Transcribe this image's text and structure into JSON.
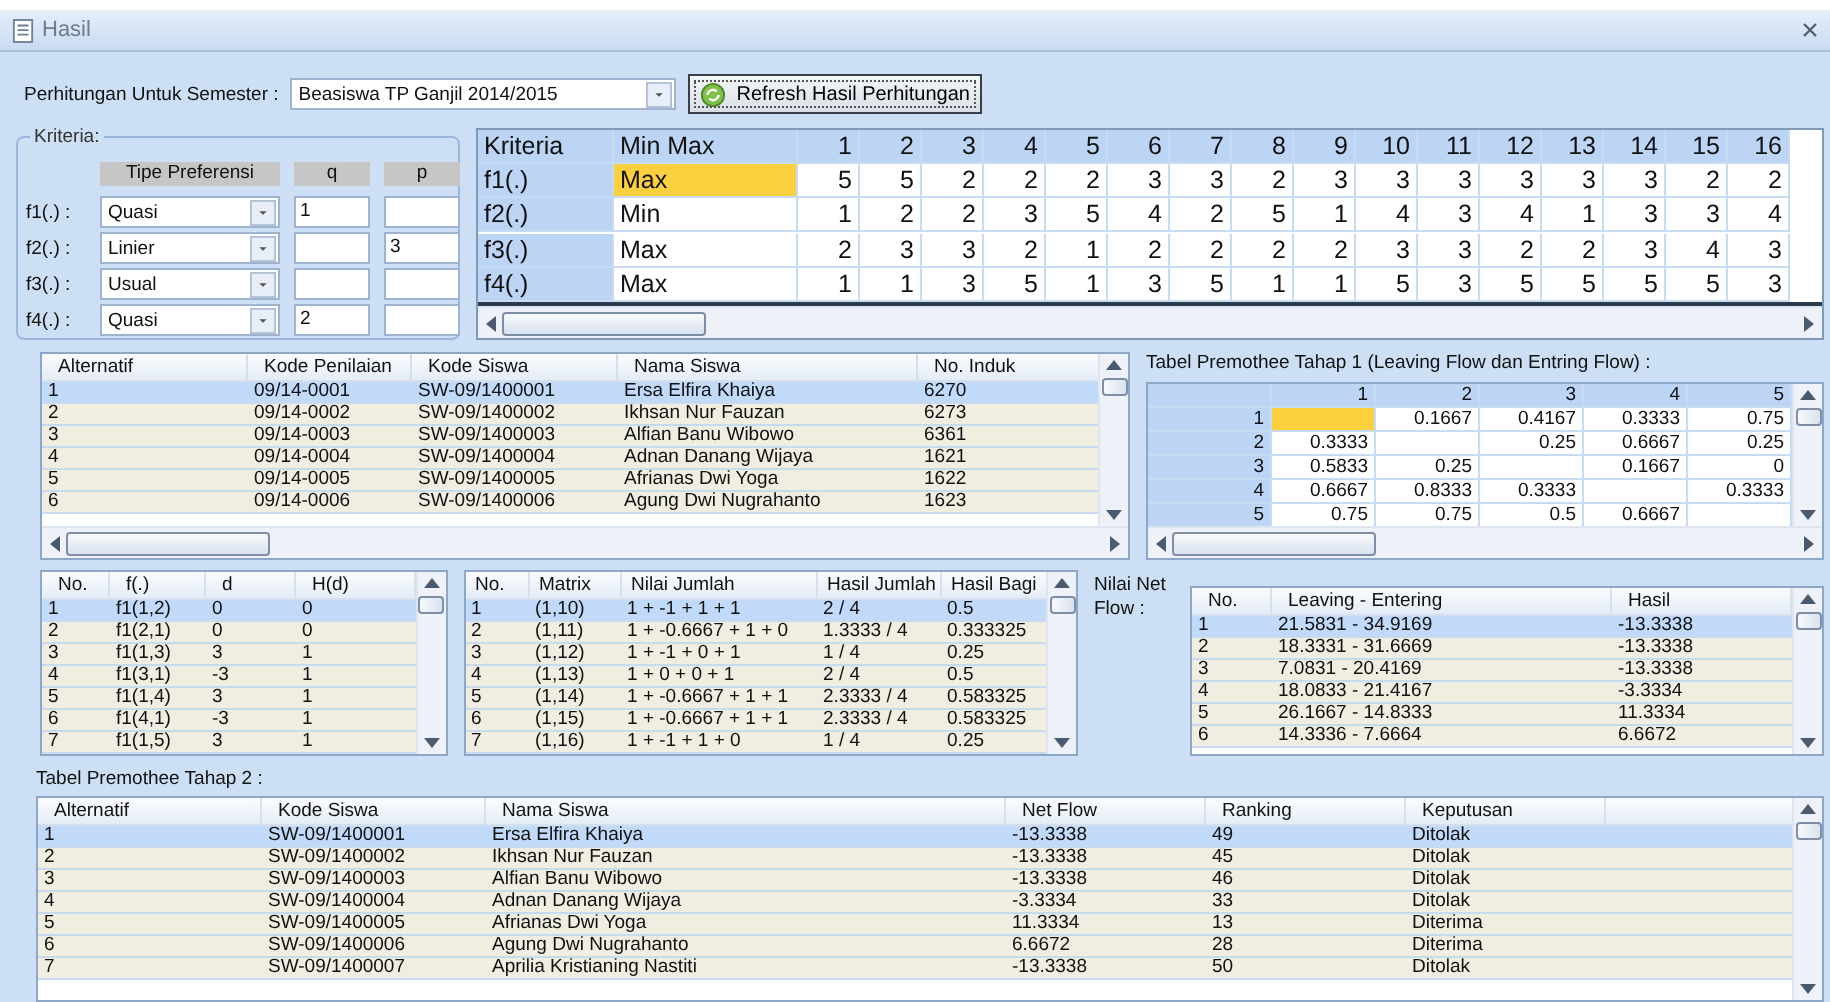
{
  "window": {
    "title": "Hasil"
  },
  "semester": {
    "label": "Perhitungan Untuk Semester :",
    "value": "Beasiswa TP Ganjil 2014/2015"
  },
  "refresh_button": {
    "label": "Refresh Hasil Perhitungan"
  },
  "kriteria": {
    "legend": "Kriteria:",
    "columns": [
      "Tipe Preferensi",
      "q",
      "p"
    ],
    "rows": [
      {
        "label": "f1(.) :",
        "type": "Quasi",
        "q": "1"
      },
      {
        "label": "f2(.) :",
        "type": "Linier",
        "p": "3"
      },
      {
        "label": "f3(.) :",
        "type": "Usual"
      },
      {
        "label": "f4(.) :",
        "type": "Quasi",
        "q": "2"
      }
    ]
  },
  "criteria_grid": {
    "columns": [
      "Kriteria",
      "Min Max",
      "1",
      "2",
      "3",
      "4",
      "5",
      "6",
      "7",
      "8",
      "9",
      "10",
      "11",
      "12",
      "13",
      "14",
      "15",
      "16"
    ],
    "rows": [
      {
        "name": "f1(.)",
        "minmax": "Max",
        "selected": true,
        "values": [
          "5",
          "5",
          "2",
          "2",
          "2",
          "3",
          "3",
          "2",
          "3",
          "3",
          "3",
          "3",
          "3",
          "3",
          "2",
          "2"
        ]
      },
      {
        "name": "f2(.)",
        "minmax": "Min",
        "selected": false,
        "values": [
          "1",
          "2",
          "2",
          "3",
          "5",
          "4",
          "2",
          "5",
          "1",
          "4",
          "3",
          "4",
          "1",
          "3",
          "3",
          "4"
        ]
      },
      {
        "name": "f3(.)",
        "minmax": "Max",
        "selected": false,
        "values": [
          "2",
          "3",
          "3",
          "2",
          "1",
          "2",
          "2",
          "2",
          "2",
          "3",
          "3",
          "2",
          "2",
          "3",
          "4",
          "3"
        ]
      },
      {
        "name": "f4(.)",
        "minmax": "Max",
        "selected": false,
        "values": [
          "1",
          "1",
          "3",
          "5",
          "1",
          "3",
          "5",
          "1",
          "1",
          "5",
          "3",
          "5",
          "5",
          "5",
          "5",
          "3"
        ]
      }
    ]
  },
  "alternatives": {
    "columns": [
      "Alternatif",
      "Kode Penilaian",
      "Kode Siswa",
      "Nama Siswa",
      "No. Induk"
    ],
    "rows": [
      {
        "selected": true,
        "cells": [
          "1",
          "09/14-0001",
          "SW-09/1400001",
          "Ersa Elfira Khaiya",
          "6270"
        ]
      },
      {
        "selected": false,
        "cells": [
          "2",
          "09/14-0002",
          "SW-09/1400002",
          "Ikhsan Nur Fauzan",
          "6273"
        ]
      },
      {
        "selected": false,
        "cells": [
          "3",
          "09/14-0003",
          "SW-09/1400003",
          "Alfian Banu Wibowo",
          "6361"
        ]
      },
      {
        "selected": false,
        "cells": [
          "4",
          "09/14-0004",
          "SW-09/1400004",
          "Adnan Danang Wijaya",
          "1621"
        ]
      },
      {
        "selected": false,
        "cells": [
          "5",
          "09/14-0005",
          "SW-09/1400005",
          "Afrianas Dwi Yoga",
          "1622"
        ]
      },
      {
        "selected": false,
        "cells": [
          "6",
          "09/14-0006",
          "SW-09/1400006",
          "Agung Dwi Nugrahanto",
          "1623"
        ]
      }
    ]
  },
  "premothee_1": {
    "title": "Tabel Premothee Tahap 1  (Leaving Flow dan Entring Flow) :",
    "columns": [
      "1",
      "2",
      "3",
      "4",
      "5"
    ],
    "rows": [
      {
        "label": "1",
        "cells": [
          {
            "selected": true
          },
          {
            "value": "0.1667"
          },
          {
            "value": "0.4167"
          },
          {
            "value": "0.3333"
          },
          {
            "value": "0.75"
          }
        ]
      },
      {
        "label": "2",
        "cells": [
          {
            "value": "0.3333"
          },
          {
            "selected": false
          },
          {
            "value": "0.25"
          },
          {
            "value": "0.6667"
          },
          {
            "value": "0.25"
          }
        ]
      },
      {
        "label": "3",
        "cells": [
          {
            "value": "0.5833"
          },
          {
            "value": "0.25"
          },
          {
            "selected": false
          },
          {
            "value": "0.1667"
          },
          {
            "value": "0"
          }
        ]
      },
      {
        "label": "4",
        "cells": [
          {
            "value": "0.6667"
          },
          {
            "value": "0.8333"
          },
          {
            "value": "0.3333"
          },
          {
            "selected": false
          },
          {
            "value": "0.3333"
          }
        ]
      },
      {
        "label": "5",
        "cells": [
          {
            "value": "0.75"
          },
          {
            "value": "0.75"
          },
          {
            "value": "0.5"
          },
          {
            "value": "0.6667"
          },
          {
            "selected": false
          }
        ]
      }
    ]
  },
  "preference_table": {
    "columns": [
      "No.",
      "f(.)",
      "d",
      "H(d)"
    ],
    "rows": [
      {
        "selected": true,
        "cells": [
          "1",
          "f1(1,2)",
          "0",
          "0"
        ]
      },
      {
        "selected": false,
        "cells": [
          "2",
          "f1(2,1)",
          "0",
          "0"
        ]
      },
      {
        "selected": false,
        "cells": [
          "3",
          "f1(1,3)",
          "3",
          "1"
        ]
      },
      {
        "selected": false,
        "cells": [
          "4",
          "f1(3,1)",
          "-3",
          "1"
        ]
      },
      {
        "selected": false,
        "cells": [
          "5",
          "f1(1,4)",
          "3",
          "1"
        ]
      },
      {
        "selected": false,
        "cells": [
          "6",
          "f1(4,1)",
          "-3",
          "1"
        ]
      },
      {
        "selected": false,
        "cells": [
          "7",
          "f1(1,5)",
          "3",
          "1"
        ]
      }
    ]
  },
  "matrix_table": {
    "columns": [
      "No.",
      "Matrix",
      "Nilai Jumlah",
      "Hasil Jumlah",
      "Hasil Bagi"
    ],
    "rows": [
      {
        "selected": true,
        "cells": [
          "1",
          "(1,10)",
          "1 + -1 + 1 + 1",
          "2 / 4",
          "0.5"
        ]
      },
      {
        "selected": false,
        "cells": [
          "2",
          "(1,11)",
          "1 + -0.6667 + 1 + 0",
          "1.3333 / 4",
          "0.333325"
        ]
      },
      {
        "selected": false,
        "cells": [
          "3",
          "(1,12)",
          "1 + -1 + 0 + 1",
          "1 / 4",
          "0.25"
        ]
      },
      {
        "selected": false,
        "cells": [
          "4",
          "(1,13)",
          "1 + 0 + 0 + 1",
          "2 / 4",
          "0.5"
        ]
      },
      {
        "selected": false,
        "cells": [
          "5",
          "(1,14)",
          "1 + -0.6667 + 1 + 1",
          "2.3333 / 4",
          "0.583325"
        ]
      },
      {
        "selected": false,
        "cells": [
          "6",
          "(1,15)",
          "1 + -0.6667 + 1 + 1",
          "2.3333 / 4",
          "0.583325"
        ]
      },
      {
        "selected": false,
        "cells": [
          "7",
          "(1,16)",
          "1 + -1 + 1 + 0",
          "1 / 4",
          "0.25"
        ]
      }
    ]
  },
  "net_flow": {
    "label": "Nilai Net Flow :",
    "columns": [
      "No.",
      "Leaving - Entering",
      "Hasil"
    ],
    "rows": [
      {
        "selected": true,
        "cells": [
          "1",
          "21.5831 - 34.9169",
          "-13.3338"
        ]
      },
      {
        "selected": false,
        "cells": [
          "2",
          "18.3331 - 31.6669",
          "-13.3338"
        ]
      },
      {
        "selected": false,
        "cells": [
          "3",
          "7.0831 - 20.4169",
          "-13.3338"
        ]
      },
      {
        "selected": false,
        "cells": [
          "4",
          "18.0833 - 21.4167",
          "-3.3334"
        ]
      },
      {
        "selected": false,
        "cells": [
          "5",
          "26.1667 - 14.8333",
          "11.3334"
        ]
      },
      {
        "selected": false,
        "cells": [
          "6",
          "14.3336 - 7.6664",
          "6.6672"
        ]
      }
    ]
  },
  "premothee_2": {
    "title": "Tabel Premothee Tahap 2 :",
    "columns": [
      "Alternatif",
      "Kode Siswa",
      "Nama Siswa",
      "Net Flow",
      "Ranking",
      "Keputusan"
    ],
    "rows": [
      {
        "selected": true,
        "cells": [
          "1",
          "SW-09/1400001",
          "Ersa Elfira Khaiya",
          "-13.3338",
          "49",
          "Ditolak"
        ]
      },
      {
        "selected": false,
        "cells": [
          "2",
          "SW-09/1400002",
          "Ikhsan Nur Fauzan",
          "-13.3338",
          "45",
          "Ditolak"
        ]
      },
      {
        "selected": false,
        "cells": [
          "3",
          "SW-09/1400003",
          "Alfian Banu Wibowo",
          "-13.3338",
          "46",
          "Ditolak"
        ]
      },
      {
        "selected": false,
        "cells": [
          "4",
          "SW-09/1400004",
          "Adnan Danang Wijaya",
          "-3.3334",
          "33",
          "Ditolak"
        ]
      },
      {
        "selected": false,
        "cells": [
          "5",
          "SW-09/1400005",
          "Afrianas Dwi Yoga",
          "11.3334",
          "13",
          "Diterima"
        ]
      },
      {
        "selected": false,
        "cells": [
          "6",
          "SW-09/1400006",
          "Agung Dwi Nugrahanto",
          "6.6672",
          "28",
          "Diterima"
        ]
      },
      {
        "selected": false,
        "cells": [
          "7",
          "SW-09/1400007",
          "Aprilia Kristianing Nastiti",
          "-13.3338",
          "50",
          "Ditolak"
        ]
      }
    ]
  }
}
